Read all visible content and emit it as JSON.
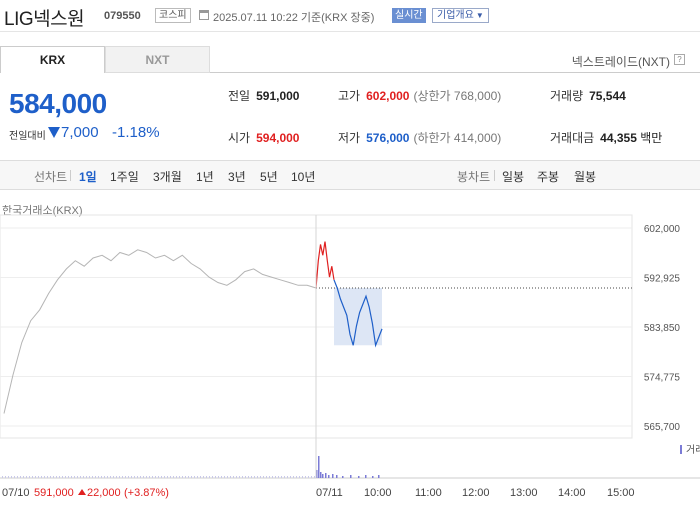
{
  "header": {
    "name": "LIG넥스원",
    "code": "079550",
    "market": "코스피",
    "datetime": "2025.07.11 10:22",
    "basis": "기준(KRX 장중)",
    "realtime_label": "실시간",
    "company_label": "기업개요"
  },
  "tabs": {
    "krx": "KRX",
    "nxt": "NXT",
    "nxt_trade_label": "넥스트레이드(NXT)"
  },
  "price": {
    "current": "584,000",
    "change_label": "전일대비",
    "change": "7,000",
    "change_pct": "-1.18%",
    "direction": "down"
  },
  "stats": {
    "prev_close_label": "전일",
    "prev_close": "591,000",
    "open_label": "시가",
    "open": "594,000",
    "high_label": "고가",
    "high": "602,000",
    "upper_limit": "(상한가 768,000)",
    "low_label": "저가",
    "low": "576,000",
    "lower_limit": "(하한가 414,000)",
    "volume_label": "거래량",
    "volume": "75,544",
    "amount_label": "거래대금",
    "amount": "44,355",
    "amount_unit": "백만"
  },
  "toolbar": {
    "line_chart_label": "선차트",
    "periods": [
      "1일",
      "1주일",
      "3개월",
      "1년",
      "3년",
      "5년",
      "10년"
    ],
    "selected_period": "1일",
    "candle_label": "봉차트",
    "candles": [
      "일봉",
      "주봉",
      "월봉"
    ]
  },
  "chart": {
    "exchange_label": "한국거래소(KRX)",
    "volume_label": "거래량",
    "prev_day_summary": {
      "date": "07/10",
      "close": "591,000",
      "change": "22,000",
      "change_pct": "(+3.87%)"
    },
    "colors": {
      "up": "#e02020",
      "down": "#1e5fc9",
      "prev_day": "#b5b5b5",
      "band": "#dde6f5"
    }
  },
  "chart_data": {
    "type": "line",
    "y_ticks": [
      "602,000",
      "592,925",
      "583,850",
      "574,775",
      "565,700"
    ],
    "ylim": [
      565700,
      602000
    ],
    "x_ticks": [
      "07/10",
      "07/11",
      "10:00",
      "11:00",
      "12:00",
      "13:00",
      "14:00",
      "15:00"
    ],
    "reference_line": 591000,
    "series": [
      {
        "values": [
          568000,
          575000,
          581000,
          585000,
          587000,
          590000,
          592500,
          594500,
          596000,
          595000,
          596500,
          597000,
          596000,
          597500,
          597000,
          598000,
          597500,
          596500,
          597000,
          596000,
          597000,
          595500,
          594500,
          593000,
          592000,
          591500,
          592500,
          594000,
          594500,
          593500,
          593000,
          592500,
          592000,
          591500,
          591500,
          591000
        ]
      },
      {
        "values": [
          591000,
          596000,
          599000,
          597000,
          599500,
          596000,
          593000,
          595000,
          592500
        ]
      },
      {
        "values": [
          592500,
          591000,
          589000,
          587500,
          586000,
          582500,
          580500,
          584000,
          586500,
          588000,
          589500,
          587500,
          584500,
          580500,
          582000,
          583500
        ]
      }
    ]
  }
}
